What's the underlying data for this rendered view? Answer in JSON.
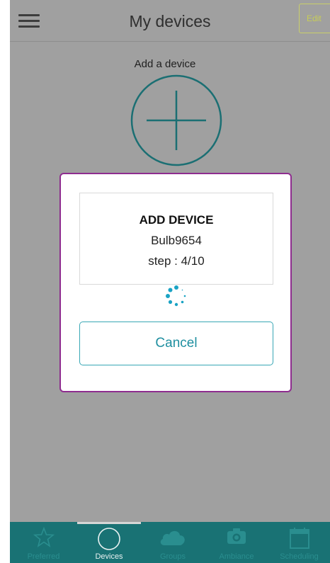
{
  "header": {
    "title": "My devices",
    "edit_label": "Edit"
  },
  "main": {
    "add_label": "Add a device"
  },
  "dialog": {
    "title": "ADD DEVICE",
    "device_name": "Bulb9654",
    "step": "step : 4/10",
    "cancel_label": "Cancel"
  },
  "bottom_nav": {
    "items": [
      {
        "label": "Preferred",
        "icon": "star-icon"
      },
      {
        "label": "Devices",
        "icon": "circle-icon",
        "active": true
      },
      {
        "label": "Groups",
        "icon": "cloud-icon"
      },
      {
        "label": "Ambiance",
        "icon": "camera-icon"
      },
      {
        "label": "Scheduling",
        "icon": "calendar-icon"
      }
    ]
  },
  "colors": {
    "overlay": "#a0a0a0",
    "accent": "#197274",
    "dialog_border": "#8e2d8f",
    "button_border": "#38a7b5"
  }
}
